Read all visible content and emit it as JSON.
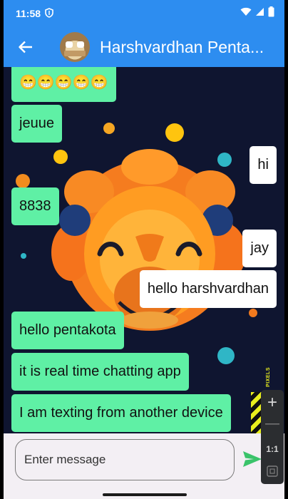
{
  "status_bar": {
    "time": "11:58"
  },
  "app_bar": {
    "title": "Harshvardhan Penta..."
  },
  "messages": [
    {
      "text": "😁😁😁😁😁",
      "direction": "received"
    },
    {
      "text": "jeuue",
      "direction": "received"
    },
    {
      "text": "hi",
      "direction": "sent"
    },
    {
      "text": "8838",
      "direction": "received"
    },
    {
      "text": "jay",
      "direction": "sent"
    },
    {
      "text": "hello harshvardhan",
      "direction": "sent"
    },
    {
      "text": "hello pentakota",
      "direction": "received"
    },
    {
      "text": "it is real time chatting app",
      "direction": "received"
    },
    {
      "text": "I am texting from another device",
      "direction": "received"
    }
  ],
  "composer": {
    "placeholder": "Enter message"
  },
  "zoom_toolbar": {
    "plus": "+",
    "minus": "—",
    "ratio": "1:1"
  },
  "overlay": {
    "tag": "PIXELS"
  },
  "colors": {
    "app_bar": "#2d8df0",
    "received_bubble": "#5ff0a5",
    "sent_bubble": "#ffffff",
    "wallpaper_bg": "#0f1530",
    "send_icon": "#3ac36a"
  },
  "icons": [
    "back-arrow-icon",
    "shield-icon",
    "wifi-icon",
    "signal-icon",
    "battery-icon",
    "send-icon",
    "fit-screen-icon"
  ]
}
